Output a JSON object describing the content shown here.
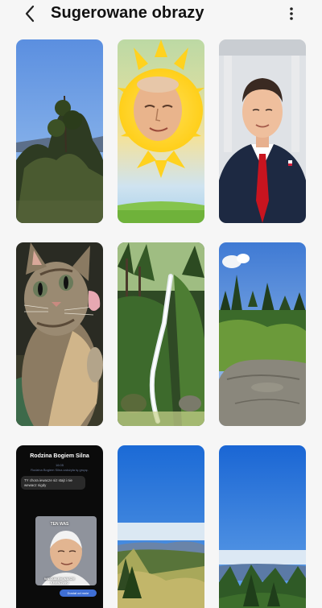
{
  "header": {
    "title": "Sugerowane obrazy",
    "back_icon": "chevron-left-icon",
    "menu_icon": "more-vertical-icon"
  },
  "tiles": [
    {
      "name": "tile-tree-landscape"
    },
    {
      "name": "tile-sun-face"
    },
    {
      "name": "tile-portrait-man"
    },
    {
      "name": "tile-cat"
    },
    {
      "name": "tile-waterfall"
    },
    {
      "name": "tile-rock-forest"
    },
    {
      "name": "tile-chat-screenshot"
    },
    {
      "name": "tile-mountain-sky-1"
    },
    {
      "name": "tile-mountain-sky-2"
    }
  ],
  "chat": {
    "title": "Rodzina Bogiem Silna",
    "meta_line": "16:05",
    "info_line_1": "Rodzina Bogiem Silna założyła tę grupę.",
    "bubble_text": "TY chora iewacze siz stajt i nie wewacz nigdy",
    "meme_top": "TEN WAS",
    "meme_bottom": "WIDZIAŁEM WASZE KRENÓWKI",
    "reply_text": "Dostał od mnie"
  },
  "colors": {
    "background": "#f6f6f6",
    "title": "#111111"
  }
}
